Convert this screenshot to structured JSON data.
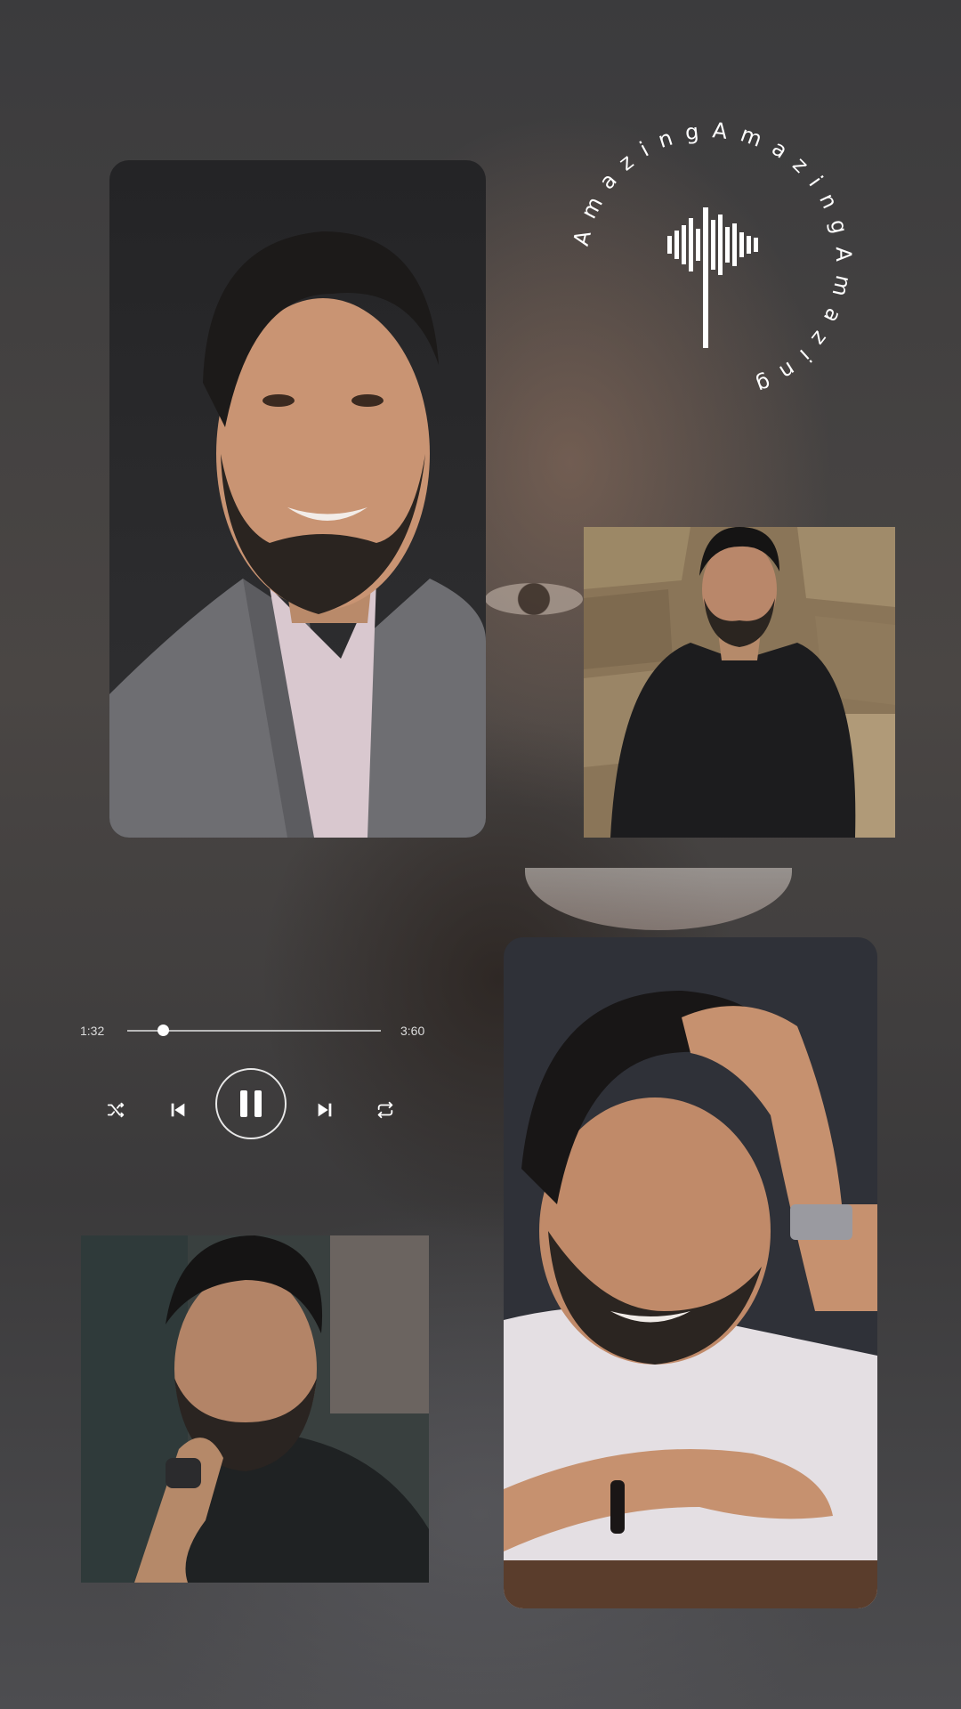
{
  "badge": {
    "text": "AmazingAmazingAmazing",
    "icon": "sound-wave-icon"
  },
  "player": {
    "elapsed": "1:32",
    "total": "3:60",
    "progress": 0.14,
    "controls": [
      "shuffle-icon",
      "skip-previous-icon",
      "pause-icon",
      "skip-next-icon",
      "repeat-icon"
    ]
  },
  "photos": [
    {
      "id": "photo-1",
      "description": "smiling-portrait-grey-suit"
    },
    {
      "id": "photo-2",
      "description": "portrait-black-shirt-stone-wall"
    },
    {
      "id": "photo-3",
      "description": "portrait-hand-in-hair-white-shirt"
    },
    {
      "id": "photo-4",
      "description": "portrait-hand-on-chin-dark-tshirt"
    }
  ],
  "colors": {
    "background": "#3a3a3c",
    "accent": "#ffffff"
  }
}
